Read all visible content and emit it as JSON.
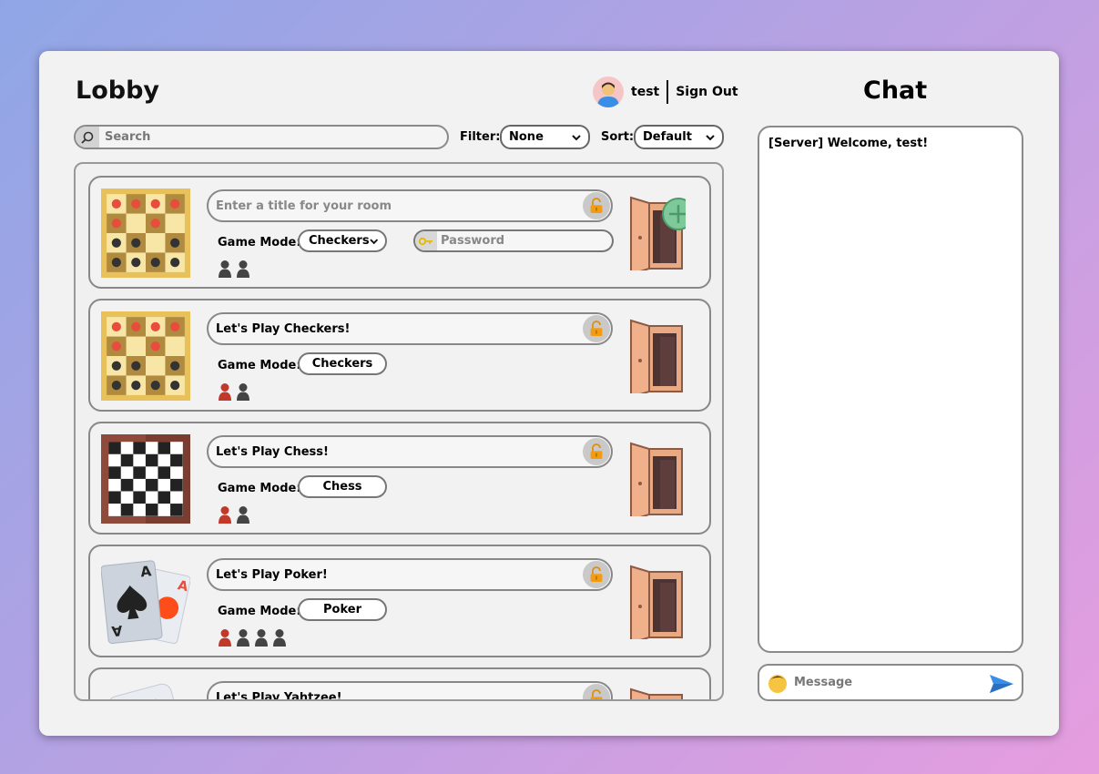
{
  "header": {
    "title": "Lobby",
    "username": "test",
    "signout_label": "Sign Out",
    "chat_title": "Chat"
  },
  "controls": {
    "search_placeholder": "Search",
    "filter_label": "Filter:",
    "filter_value": "None",
    "sort_label": "Sort:",
    "sort_value": "Default"
  },
  "new_room": {
    "title_placeholder": "Enter a title for your room",
    "game_mode_label": "Game Mode:",
    "game_mode_value": "Checkers",
    "password_placeholder": "Password",
    "players": [
      "empty",
      "empty"
    ]
  },
  "rooms": [
    {
      "title": "Let's Play Checkers!",
      "game_mode_label": "Game Mode:",
      "game_mode": "Checkers",
      "thumbnail": "checkers-board-icon",
      "players": [
        "filled",
        "empty"
      ]
    },
    {
      "title": "Let's Play Chess!",
      "game_mode_label": "Game Mode:",
      "game_mode": "Chess",
      "thumbnail": "chess-board-icon",
      "players": [
        "filled",
        "empty"
      ]
    },
    {
      "title": "Let's Play Poker!",
      "game_mode_label": "Game Mode:",
      "game_mode": "Poker",
      "thumbnail": "playing-cards-icon",
      "players": [
        "filled",
        "empty",
        "empty",
        "empty"
      ]
    },
    {
      "title": "Let's Play Yahtzee!",
      "thumbnail": "dice-icon"
    }
  ],
  "chat": {
    "messages": [
      "[Server] Welcome, test!"
    ],
    "message_placeholder": "Message"
  },
  "colors": {
    "player_filled": "#c0392b",
    "player_empty": "#444444",
    "lock": "#f39c12",
    "add": "#7fc89a",
    "send": "#3a8ee6"
  }
}
